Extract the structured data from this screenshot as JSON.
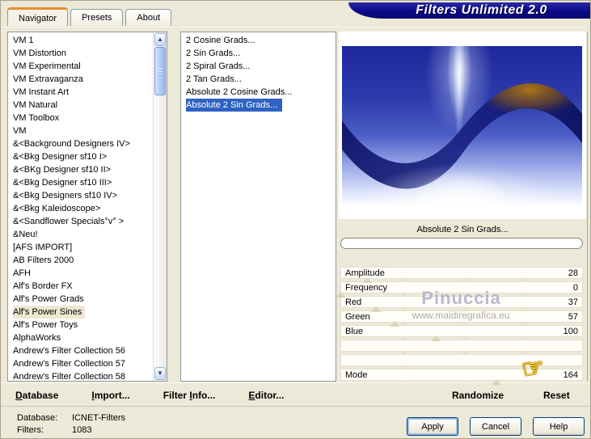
{
  "window": {
    "title": "Filters Unlimited 2.0"
  },
  "tabs": [
    {
      "label": "Navigator",
      "active": true
    },
    {
      "label": "Presets",
      "active": false
    },
    {
      "label": "About",
      "active": false
    }
  ],
  "category_list": {
    "items": [
      {
        "label": "VM 1"
      },
      {
        "label": "VM Distortion"
      },
      {
        "label": "VM Experimental"
      },
      {
        "label": "VM Extravaganza"
      },
      {
        "label": "VM Instant Art"
      },
      {
        "label": "VM Natural"
      },
      {
        "label": "VM Toolbox"
      },
      {
        "label": "VM"
      },
      {
        "label": "&<Background Designers IV>"
      },
      {
        "label": "&<Bkg Designer sf10 I>"
      },
      {
        "label": "&<BKg Designer sf10 II>"
      },
      {
        "label": "&<Bkg Designer sf10 III>"
      },
      {
        "label": "&<Bkg Designers sf10 IV>"
      },
      {
        "label": "&<Bkg Kaleidoscope>"
      },
      {
        "label": "&<Sandflower Specials°v° >"
      },
      {
        "label": "&Neu!"
      },
      {
        "label": "[AFS IMPORT]"
      },
      {
        "label": "AB Filters 2000"
      },
      {
        "label": "AFH"
      },
      {
        "label": "Alf's Border FX"
      },
      {
        "label": "Alf's Power Grads"
      },
      {
        "label": "Alf's Power Sines",
        "selected": true
      },
      {
        "label": "Alf's Power Toys"
      },
      {
        "label": "AlphaWorks"
      },
      {
        "label": "Andrew's Filter Collection 56"
      },
      {
        "label": "Andrew's Filter Collection 57"
      },
      {
        "label": "Andrew's Filter Collection 58"
      }
    ]
  },
  "filter_list": {
    "items": [
      {
        "label": "2 Cosine Grads..."
      },
      {
        "label": "2 Sin Grads..."
      },
      {
        "label": "2 Spiral Grads..."
      },
      {
        "label": "2 Tan Grads..."
      },
      {
        "label": "Absolute 2 Cosine Grads..."
      },
      {
        "label": "Absolute 2 Sin Grads...",
        "selected": true
      }
    ]
  },
  "preview": {
    "caption": "Absolute 2 Sin Grads...",
    "progress_value": 0
  },
  "sliders": [
    {
      "label": "Amplitude",
      "value": 28,
      "max": 255
    },
    {
      "label": "Frequency",
      "value": 0,
      "max": 255
    },
    {
      "label": "Red",
      "value": 37,
      "max": 255
    },
    {
      "label": "Green",
      "value": 57,
      "max": 255
    },
    {
      "label": "Blue",
      "value": 100,
      "max": 255
    },
    {
      "label": "",
      "value": null,
      "max": null
    },
    {
      "label": "",
      "value": null,
      "max": null
    },
    {
      "label": "Mode",
      "value": 164,
      "max": 255
    }
  ],
  "actions": {
    "randomize_label": "Randomize",
    "reset_label": "Reset"
  },
  "toolbar": {
    "items": [
      {
        "pre": "",
        "u": "D",
        "post": "atabase"
      },
      {
        "pre": "",
        "u": "I",
        "post": "mport..."
      },
      {
        "pre": "Filter ",
        "u": "I",
        "post": "nfo..."
      },
      {
        "pre": "",
        "u": "E",
        "post": "ditor..."
      }
    ]
  },
  "status": {
    "database_label": "Database:",
    "database_value": "ICNET-Filters",
    "filters_label": "Filters:",
    "filters_value": "1083"
  },
  "dialog_buttons": [
    {
      "label": "Apply",
      "default": true
    },
    {
      "label": "Cancel"
    },
    {
      "label": "Help"
    }
  ],
  "watermark": {
    "line1": "Pinuccia",
    "line2": "www.maidiregrafica.eu"
  },
  "icons": {
    "hand_cursor": "☞",
    "scroll_up": "▲",
    "scroll_down": "▼"
  },
  "colors": {
    "background": "#ece9d8",
    "banner_navy": "#0a0a88",
    "selection_blue": "#2f62c2",
    "category_selection": "#eee8d0",
    "tab_accent_orange": "#e5902a"
  }
}
